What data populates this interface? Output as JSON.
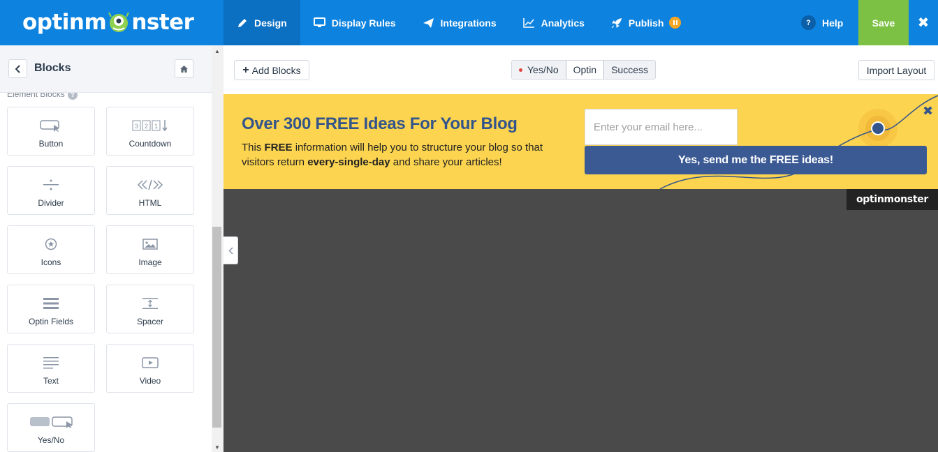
{
  "app": {
    "logo_text_left": "optinm",
    "logo_text_right": "nster"
  },
  "nav": {
    "items": [
      {
        "label": "Design",
        "icon": "pencil-icon",
        "active": true
      },
      {
        "label": "Display Rules",
        "icon": "monitor-icon"
      },
      {
        "label": "Integrations",
        "icon": "paper-plane-icon"
      },
      {
        "label": "Analytics",
        "icon": "line-chart-icon"
      },
      {
        "label": "Publish",
        "icon": "rocket-icon",
        "badge": "pause-icon"
      }
    ],
    "help_label": "Help",
    "help_icon_text": "?",
    "save_label": "Save",
    "close_glyph": "✖"
  },
  "sidebar": {
    "title": "Blocks",
    "section_label": "Element Blocks",
    "section_help": "?",
    "blocks": [
      {
        "label": "Button",
        "icon": "button-cursor-icon"
      },
      {
        "label": "Countdown",
        "icon": "countdown-icon"
      },
      {
        "label": "Divider",
        "icon": "divider-icon"
      },
      {
        "label": "HTML",
        "icon": "code-icon"
      },
      {
        "label": "Icons",
        "icon": "star-circle-icon"
      },
      {
        "label": "Image",
        "icon": "image-icon"
      },
      {
        "label": "Optin Fields",
        "icon": "fields-icon"
      },
      {
        "label": "Spacer",
        "icon": "spacer-icon"
      },
      {
        "label": "Text",
        "icon": "text-lines-icon"
      },
      {
        "label": "Video",
        "icon": "video-play-icon"
      },
      {
        "label": "Yes/No",
        "icon": "yes-no-icon"
      }
    ]
  },
  "toolbar": {
    "add_blocks_label": "Add Blocks",
    "add_blocks_glyph": "+",
    "view_tabs": [
      {
        "label": "Yes/No",
        "dot": true
      },
      {
        "label": "Optin",
        "selected": true
      },
      {
        "label": "Success"
      }
    ],
    "import_label": "Import Layout"
  },
  "optin": {
    "headline": "Over 300 FREE Ideas For Your Blog",
    "sub_1": "This ",
    "sub_2": "FREE",
    "sub_3": " information will help you to structure your blog so that visitors return ",
    "sub_4": "every-single-day",
    "sub_5": " and share your articles!",
    "email_placeholder": "Enter your email here...",
    "cta_label": "Yes, send me the FREE ideas!",
    "close_glyph": "✖",
    "powered_by": "optinmonster"
  },
  "colors": {
    "nav_bg": "#0d82df",
    "nav_active": "#0b6fc2",
    "save_green": "#7cc143",
    "banner_yellow": "#fcd44f",
    "headline_blue": "#34558b",
    "cta_blue": "#3b5a94",
    "canvas_gray": "#4a4a4a",
    "publish_badge": "#f5a623"
  }
}
